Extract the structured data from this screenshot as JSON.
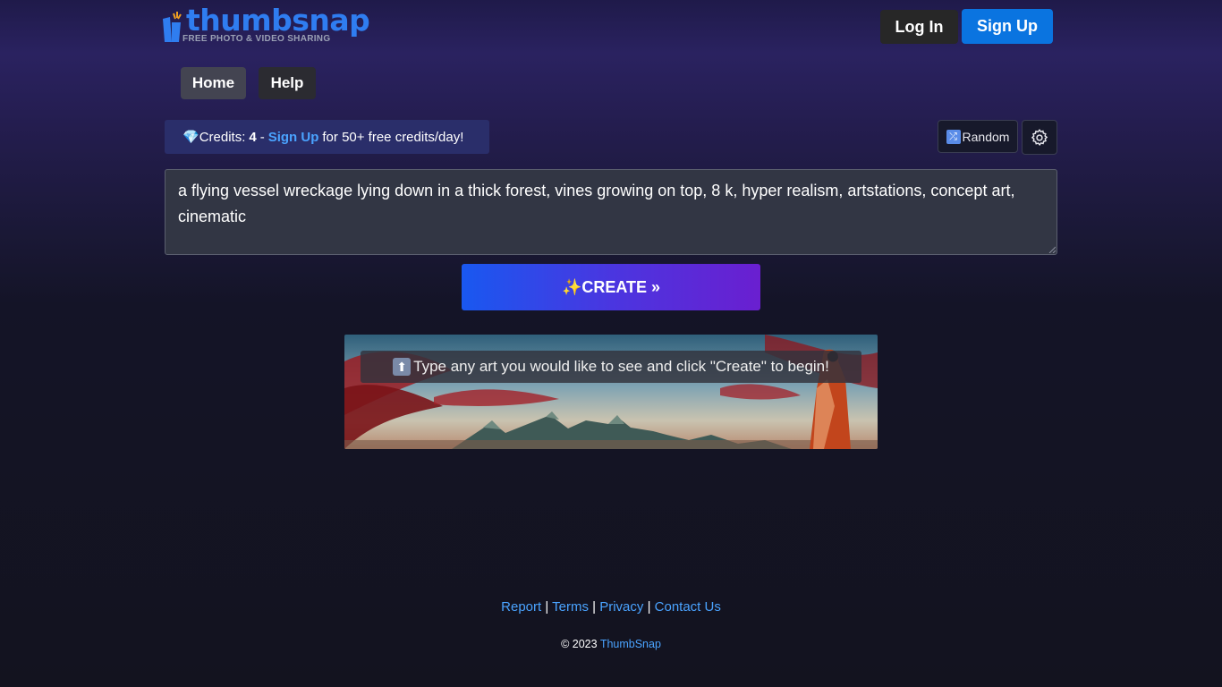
{
  "logo": {
    "name": "thumbsnap",
    "tagline": "FREE PHOTO & VIDEO SHARING"
  },
  "header": {
    "login_label": "Log In",
    "signup_label": "Sign Up"
  },
  "nav": {
    "home_label": "Home",
    "help_label": "Help"
  },
  "credits": {
    "icon": "💎",
    "label": "Credits:",
    "count": "4",
    "separator": "-",
    "signup_link": "Sign Up",
    "suffix": "for 50+ free credits/day!"
  },
  "toolbar": {
    "random_label": "Random",
    "random_icon": "shuffle-icon",
    "settings_icon": "gear-icon"
  },
  "prompt": {
    "value": "a flying vessel wreckage lying down in a thick forest, vines growing on top, 8 k, hyper realism, artstations, concept art, cinematic"
  },
  "create_button": {
    "label": "✨CREATE »"
  },
  "banner": {
    "hint": "Type any art you would like to see and click \"Create\" to begin!",
    "hint_icon": "up-arrow-icon"
  },
  "footer": {
    "links": [
      "Report",
      "Terms",
      "Privacy",
      "Contact Us"
    ],
    "copyright_prefix": "© 2023",
    "copyright_link": "ThumbSnap"
  },
  "colors": {
    "accent": "#0a74e0",
    "link": "#4aa3ff",
    "background": "#13131f"
  }
}
